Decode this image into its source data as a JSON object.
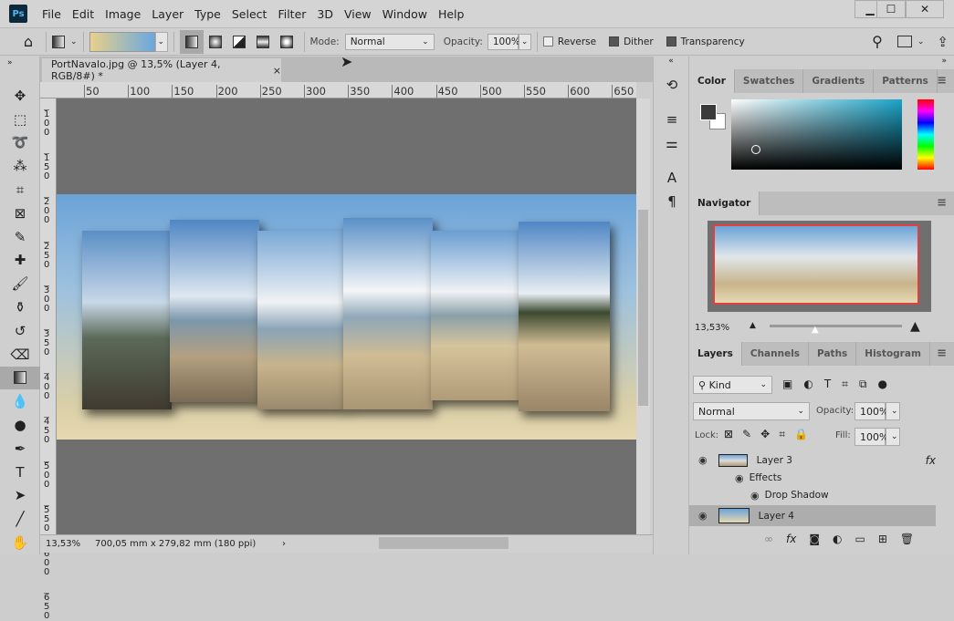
{
  "app": {
    "logo": "Ps"
  },
  "menu": [
    "File",
    "Edit",
    "Image",
    "Layer",
    "Type",
    "Select",
    "Filter",
    "3D",
    "View",
    "Window",
    "Help"
  ],
  "window_controls": {
    "minimize": "▁",
    "maximize": "☐",
    "close": "✕"
  },
  "options": {
    "mode_label": "Mode:",
    "mode_value": "Normal",
    "opacity_label": "Opacity:",
    "opacity_value": "100%",
    "reverse_label": "Reverse",
    "reverse_checked": false,
    "dither_label": "Dither",
    "dither_checked": true,
    "transparency_label": "Transparency",
    "transparency_checked": true,
    "gradient_colors": [
      "#e8d08a",
      "#6aa8e0"
    ]
  },
  "document": {
    "tab_title": "PortNavalo.jpg @ 13,5% (Layer 4, RGB/8#) *",
    "close": "×"
  },
  "ruler": {
    "h": [
      "50",
      "100",
      "150",
      "200",
      "250",
      "300",
      "350",
      "400",
      "450",
      "500",
      "550",
      "600",
      "650"
    ],
    "v": [
      "1\n0\n0",
      "1\n5\n0",
      "2\n0\n0",
      "2\n5\n0",
      "3\n0\n0",
      "3\n5\n0",
      "4\n0\n0",
      "4\n5\n0",
      "5\n0\n0",
      "5\n5\n0",
      "6\n0\n0",
      "6\n5\n0"
    ]
  },
  "status": {
    "zoom": "13,53%",
    "doc_size": "700,05 mm x 279,82 mm (180 ppi)",
    "arrow": "›"
  },
  "color_panel": {
    "tabs": [
      "Color",
      "Swatches",
      "Gradients",
      "Patterns"
    ],
    "foreground": "#3a3a3a",
    "background": "#ffffff",
    "hue": "#1aa3c8"
  },
  "navigator": {
    "title": "Navigator",
    "zoom": "13,53%"
  },
  "layers_panel": {
    "tabs": [
      "Layers",
      "Channels",
      "Paths",
      "Histogram"
    ],
    "filter_kind": "Kind",
    "blend_mode": "Normal",
    "opacity_label": "Opacity:",
    "opacity": "100%",
    "lock_label": "Lock:",
    "fill_label": "Fill:",
    "fill": "100%",
    "layers": [
      {
        "name": "Layer 3",
        "fx": "fx",
        "effects_label": "Effects",
        "effect": "Drop Shadow"
      },
      {
        "name": "Layer 4"
      }
    ]
  },
  "footer_icons": [
    "link-icon",
    "fx-icon",
    "mask-icon",
    "adjustment-icon",
    "folder-icon",
    "new-layer-icon",
    "trash-icon"
  ]
}
